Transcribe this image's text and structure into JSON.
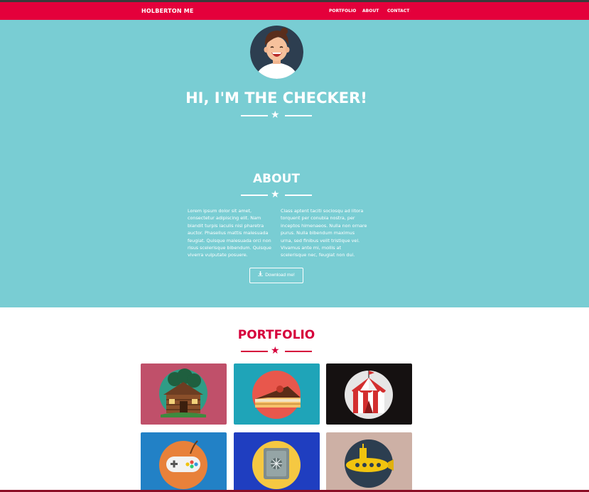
{
  "nav": {
    "brand": "HOLBERTON ME",
    "links": [
      "PORTFOLIO",
      "ABOUT",
      "CONTACT"
    ]
  },
  "hero": {
    "title": "HI, I'M THE CHECKER!"
  },
  "about": {
    "title": "ABOUT",
    "col1": "Lorem ipsum dolor sit amet, consectetur adipiscing elit. Nam blandit turpis iaculis nisl pharetra auctor. Phasellus mattis malesuada feugiat. Quisque malesuada orci non risus scelerisque bibendum. Quisque viverra vulputate posuere.",
    "col2": "Class aptent taciti sociosqu ad litora torquent per conubia nostra, per inceptos himenaeos. Nulla non ornare purus. Nulla bibendum maximus urna, sed finibus velit tristique vel. Vivamus ante mi, mollis at scelerisque nec, feugiat non dui.",
    "download_label": "Download me!"
  },
  "portfolio": {
    "title": "PORTFOLIO",
    "tiles": [
      {
        "icon": "cabin-icon",
        "bg": "#c0506a"
      },
      {
        "icon": "cake-icon",
        "bg": "#1fa4b8"
      },
      {
        "icon": "circus-tent-icon",
        "bg": "#151111"
      },
      {
        "icon": "game-controller-icon",
        "bg": "#2281c6"
      },
      {
        "icon": "safe-icon",
        "bg": "#1f3ec0"
      },
      {
        "icon": "submarine-icon",
        "bg": "#cdb0a5"
      }
    ]
  },
  "colors": {
    "navbar": "#e4003b",
    "hero": "#79cdd3",
    "accent": "#d6003b"
  }
}
